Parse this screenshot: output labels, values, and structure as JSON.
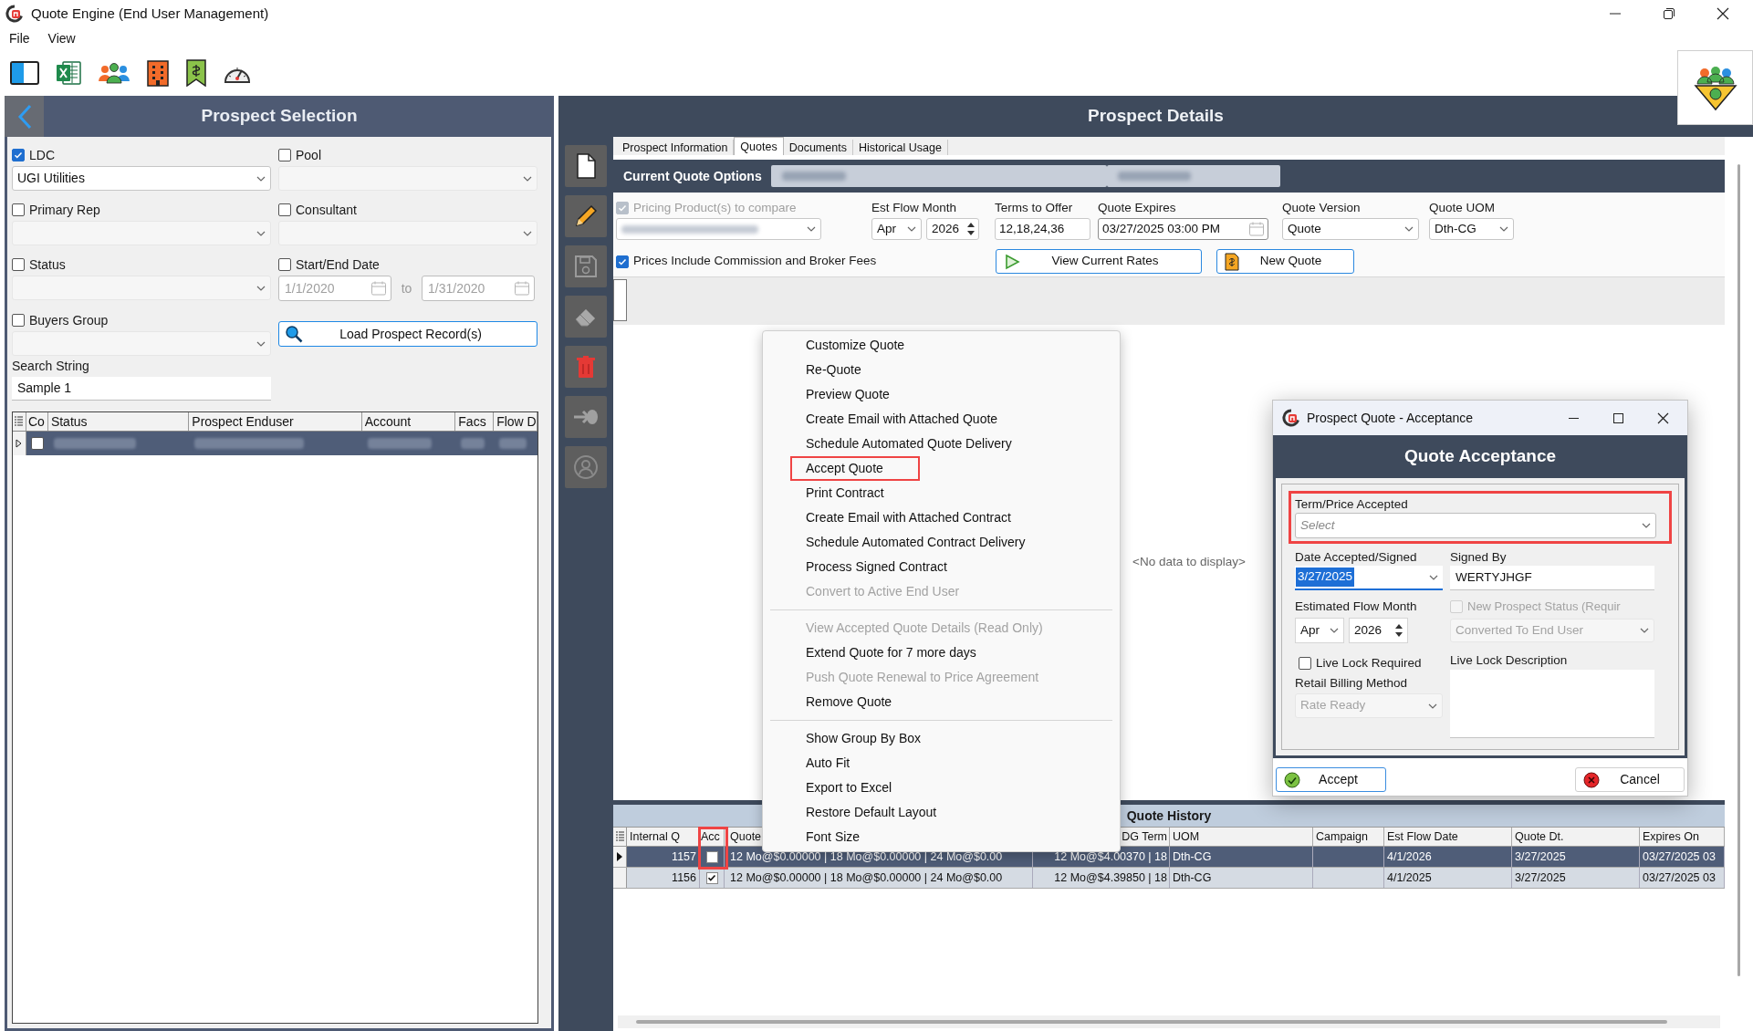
{
  "window": {
    "title": "Quote Engine (End User Management)"
  },
  "menu_bar": [
    "File",
    "View"
  ],
  "prospect_selection": {
    "title": "Prospect Selection",
    "ldc": {
      "label": "LDC",
      "checked": true,
      "value": "UGI Utilities"
    },
    "pool": {
      "label": "Pool",
      "checked": false
    },
    "primary_rep": {
      "label": "Primary Rep",
      "checked": false
    },
    "consultant": {
      "label": "Consultant",
      "checked": false
    },
    "status": {
      "label": "Status",
      "checked": false
    },
    "start_end_date": {
      "label": "Start/End Date",
      "checked": false,
      "from": "1/1/2020",
      "to_label": "to",
      "to": "1/31/2020"
    },
    "buyers_group": {
      "label": "Buyers Group",
      "checked": false
    },
    "load_button": "Load Prospect Record(s)",
    "search_string": {
      "label": "Search String",
      "value": "Sample 1"
    },
    "grid": {
      "columns": [
        "Co",
        "Status",
        "Prospect Enduser",
        "Account",
        "Facs",
        "Flow D"
      ],
      "rows": [
        {
          "selected": true,
          "checked": false
        }
      ]
    }
  },
  "prospect_details": {
    "title": "Prospect Details",
    "tabs": [
      {
        "label": "Prospect Information",
        "selected": false
      },
      {
        "label": "Quotes",
        "selected": true
      },
      {
        "label": "Documents",
        "selected": false
      },
      {
        "label": "Historical Usage",
        "selected": false
      }
    ],
    "current_quote_options": "Current Quote Options",
    "pricing_products": {
      "label": "Pricing Product(s) to compare",
      "checked": true,
      "disabled": true
    },
    "est_flow_month": {
      "label": "Est Flow Month",
      "month": "Apr",
      "year": "2026"
    },
    "terms_to_offer": {
      "label": "Terms to Offer",
      "value": "12,18,24,36"
    },
    "quote_expires": {
      "label": "Quote Expires",
      "value": "03/27/2025 03:00 PM"
    },
    "quote_version": {
      "label": "Quote Version",
      "value": "Quote"
    },
    "quote_uom": {
      "label": "Quote UOM",
      "value": "Dth-CG"
    },
    "prices_include": {
      "label": "Prices Include Commission and Broker Fees",
      "checked": true
    },
    "buttons": [
      {
        "kind": "view_rates",
        "label": "View Current Rates"
      },
      {
        "kind": "new_quote",
        "label": "New Quote"
      }
    ],
    "empty_message": "<No data to display>",
    "quote_history": {
      "title": "Quote History",
      "columns": [
        {
          "label": "Internal Q",
          "highlighted": false
        },
        {
          "label": "Acc",
          "highlighted": true
        },
        {
          "label": "Quote",
          "highlighted": false
        },
        {
          "label": "DG Term",
          "highlighted": false
        },
        {
          "label": "UOM",
          "highlighted": false
        },
        {
          "label": "Campaign",
          "highlighted": false
        },
        {
          "label": "Est Flow Date",
          "highlighted": false
        },
        {
          "label": "Quote Dt.",
          "highlighted": false
        },
        {
          "label": "Expires On",
          "highlighted": false
        }
      ],
      "rows": [
        {
          "selected": true,
          "accepted": false,
          "internal": "1157",
          "quote": "12 Mo@$0.00000 | 18 Mo@$0.00000 | 24 Mo@$0.00",
          "dg_term": "12 Mo@$4.00370 | 18",
          "uom": "Dth-CG",
          "est_flow_date": "4/1/2026",
          "quote_dt": "3/27/2025",
          "expires_on": "03/27/2025 03"
        },
        {
          "selected": false,
          "accepted": true,
          "internal": "1156",
          "quote": "12 Mo@$0.00000 | 18 Mo@$0.00000 | 24 Mo@$0.00",
          "dg_term": "12 Mo@$4.39850 | 18",
          "uom": "Dth-CG",
          "est_flow_date": "4/1/2025",
          "quote_dt": "3/27/2025",
          "expires_on": "03/27/2025 03"
        }
      ]
    }
  },
  "context_menu": {
    "groups": [
      [
        {
          "label": "Customize Quote",
          "disabled": false,
          "highlighted": false
        },
        {
          "label": "Re-Quote",
          "disabled": false,
          "highlighted": false
        },
        {
          "label": "Preview Quote",
          "disabled": false,
          "highlighted": false
        },
        {
          "label": "Create Email with Attached Quote",
          "disabled": false,
          "highlighted": false
        },
        {
          "label": "Schedule Automated Quote Delivery",
          "disabled": false,
          "highlighted": false
        },
        {
          "label": "Accept Quote",
          "disabled": false,
          "highlighted": true
        },
        {
          "label": "Print Contract",
          "disabled": false,
          "highlighted": false
        },
        {
          "label": "Create Email with Attached Contract",
          "disabled": false,
          "highlighted": false
        },
        {
          "label": "Schedule Automated Contract Delivery",
          "disabled": false,
          "highlighted": false
        },
        {
          "label": "Process Signed Contract",
          "disabled": false,
          "highlighted": false
        },
        {
          "label": "Convert to Active End User",
          "disabled": true,
          "highlighted": false
        }
      ],
      [
        {
          "label": "View Accepted Quote Details (Read Only)",
          "disabled": true,
          "highlighted": false
        },
        {
          "label": "Extend Quote for 7 more days",
          "disabled": false,
          "highlighted": false
        },
        {
          "label": "Push Quote Renewal to  Price Agreement",
          "disabled": true,
          "highlighted": false
        },
        {
          "label": "Remove Quote",
          "disabled": false,
          "highlighted": false
        }
      ],
      [
        {
          "label": "Show Group By Box",
          "disabled": false,
          "highlighted": false
        },
        {
          "label": "Auto Fit",
          "disabled": false,
          "highlighted": false
        },
        {
          "label": "Export to Excel",
          "disabled": false,
          "highlighted": false
        },
        {
          "label": "Restore Default Layout",
          "disabled": false,
          "highlighted": false
        },
        {
          "label": "Font Size",
          "disabled": false,
          "highlighted": false
        }
      ]
    ]
  },
  "dialog": {
    "title": "Prospect Quote - Acceptance",
    "heading": "Quote Acceptance",
    "term_price": {
      "label": "Term/Price Accepted",
      "placeholder": "Select",
      "highlighted": true
    },
    "date_accepted": {
      "label": "Date Accepted/Signed",
      "value": "3/27/2025",
      "text_selected": true
    },
    "signed_by": {
      "label": "Signed By",
      "value": "WERTYJHGF"
    },
    "estimated_flow_month": {
      "label": "Estimated Flow Month",
      "month": "Apr",
      "year": "2026"
    },
    "new_prospect_status": {
      "label": "New Prospect Status (Requir",
      "checked": false,
      "disabled": true,
      "value": "Converted To End User"
    },
    "live_lock": {
      "label": "Live Lock Required",
      "checked": false
    },
    "retail_billing": {
      "label": "Retail Billing Method",
      "value": "Rate Ready",
      "disabled": true
    },
    "live_lock_description": {
      "label": "Live Lock Description"
    },
    "accept_button": "Accept",
    "cancel_button": "Cancel"
  }
}
